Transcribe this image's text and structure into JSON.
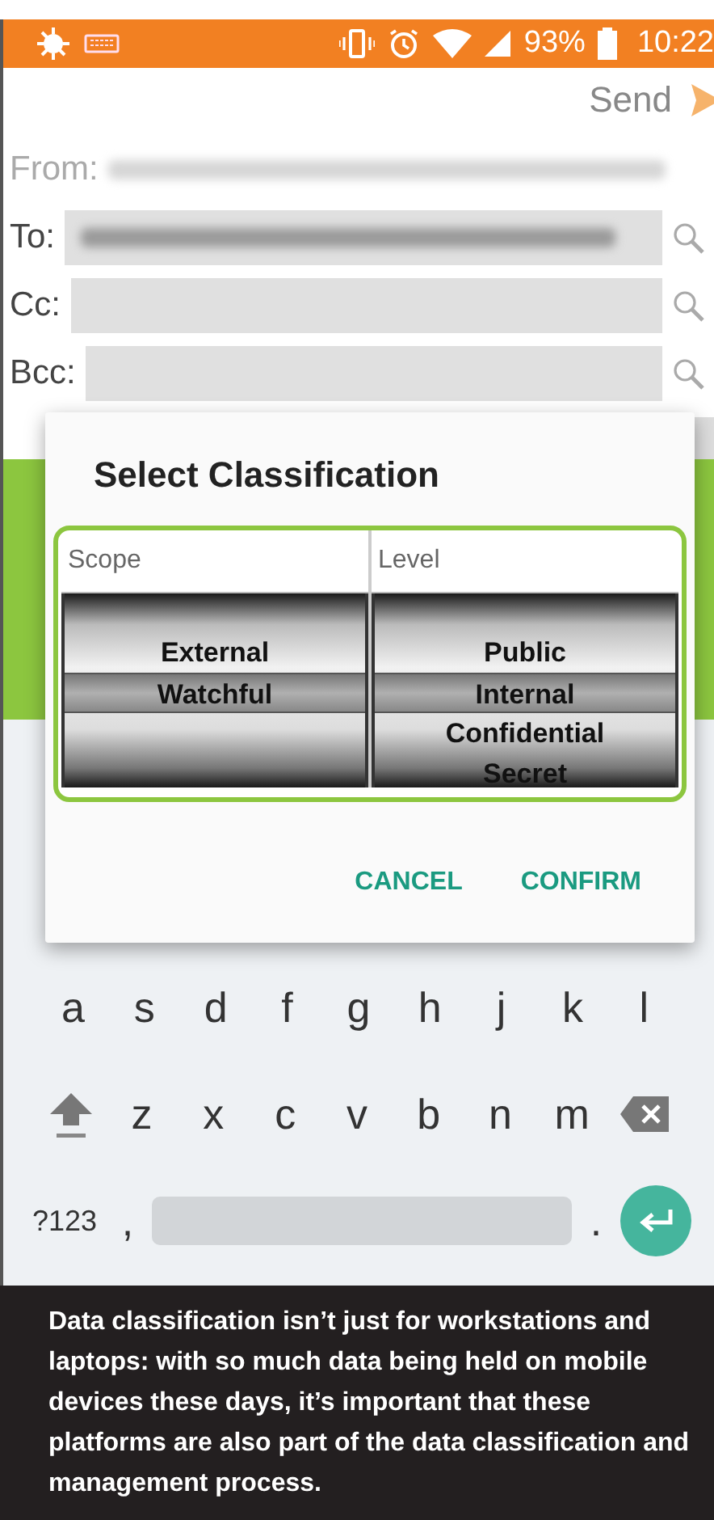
{
  "status_bar": {
    "battery": "93%",
    "time": "10:22"
  },
  "toolbar": {
    "send": "Send"
  },
  "fields": [
    {
      "label": "From:",
      "kind": "plain",
      "filled": true
    },
    {
      "label": "To:",
      "kind": "lookup",
      "filled": true
    },
    {
      "label": "Cc:",
      "kind": "lookup",
      "filled": false
    },
    {
      "label": "Bcc:",
      "kind": "lookup",
      "filled": false
    }
  ],
  "dialog": {
    "title": "Select Classification",
    "columns": [
      {
        "header": "Scope",
        "items": [
          {
            "label": "External",
            "selected": false
          },
          {
            "label": "Watchful",
            "selected": true
          }
        ]
      },
      {
        "header": "Level",
        "items": [
          {
            "label": "Public",
            "selected": false
          },
          {
            "label": "Internal",
            "selected": true
          },
          {
            "label": "Confidential",
            "selected": false
          },
          {
            "label": "Secret",
            "selected": false
          }
        ]
      }
    ],
    "buttons": [
      "CANCEL",
      "CONFIRM"
    ]
  },
  "keyboard": {
    "rows": [
      {
        "keys": [
          {
            "kind": "letter",
            "label": "a"
          },
          {
            "kind": "letter",
            "label": "s"
          },
          {
            "kind": "letter",
            "label": "d"
          },
          {
            "kind": "letter",
            "label": "f"
          },
          {
            "kind": "letter",
            "label": "g"
          },
          {
            "kind": "letter",
            "label": "h"
          },
          {
            "kind": "letter",
            "label": "j"
          },
          {
            "kind": "letter",
            "label": "k"
          },
          {
            "kind": "letter",
            "label": "l"
          }
        ]
      },
      {
        "keys": [
          {
            "kind": "shift"
          },
          {
            "kind": "letter",
            "label": "z"
          },
          {
            "kind": "letter",
            "label": "x"
          },
          {
            "kind": "letter",
            "label": "c"
          },
          {
            "kind": "letter",
            "label": "v"
          },
          {
            "kind": "letter",
            "label": "b"
          },
          {
            "kind": "letter",
            "label": "n"
          },
          {
            "kind": "letter",
            "label": "m"
          },
          {
            "kind": "backspace"
          }
        ]
      },
      {
        "keys": [
          {
            "kind": "symbols",
            "label": "?123"
          },
          {
            "kind": "letter",
            "label": ","
          },
          {
            "kind": "space"
          },
          {
            "kind": "letter",
            "label": "."
          },
          {
            "kind": "enter"
          }
        ]
      }
    ]
  },
  "caption": "Data classification isn’t just for workstations and laptops: with so much data being held on mobile devices these days, it’s important that these platforms are also part of the data classification and management process."
}
